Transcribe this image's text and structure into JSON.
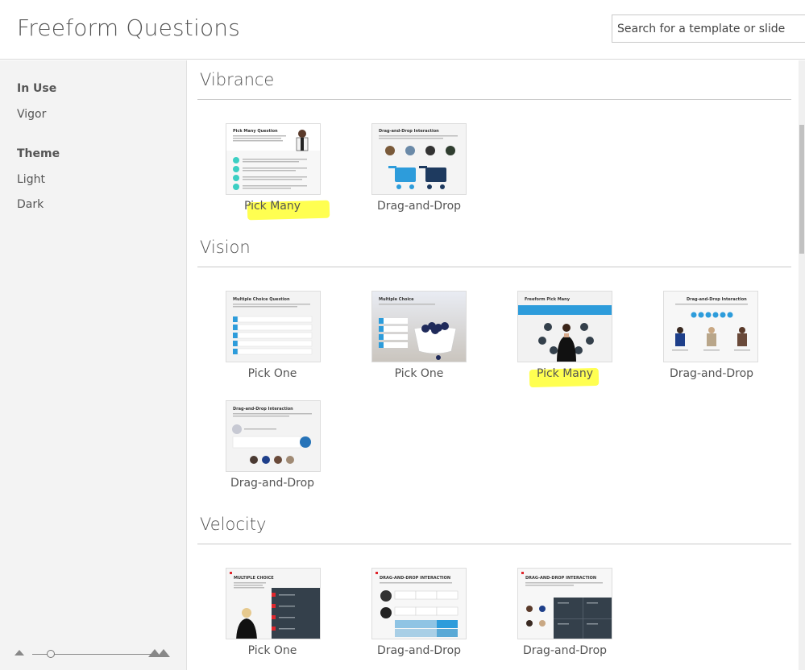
{
  "header": {
    "title": "Freeform Questions",
    "search_placeholder": "Search for a template or slide"
  },
  "sidebar": {
    "in_use_heading": "In Use",
    "in_use_item": "Vigor",
    "theme_heading": "Theme",
    "theme_items": [
      "Light",
      "Dark"
    ]
  },
  "sections": [
    {
      "title": "Vibrance",
      "cards": [
        {
          "label": "Pick Many",
          "thumb_title": "Pick Many Question",
          "highlighted": true
        },
        {
          "label": "Drag-and-Drop",
          "thumb_title": "Drag-and-Drop Interaction"
        }
      ]
    },
    {
      "title": "Vision",
      "cards": [
        {
          "label": "Pick One",
          "thumb_title": "Multiple Choice Question"
        },
        {
          "label": "Pick One",
          "thumb_title": "Multiple Choice"
        },
        {
          "label": "Pick Many",
          "thumb_title": "Freeform Pick Many",
          "highlighted": true
        },
        {
          "label": "Drag-and-Drop",
          "thumb_title": "Drag-and-Drop Interaction"
        },
        {
          "label": "Drag-and-Drop",
          "thumb_title": "Drag-and-Drop Interaction"
        }
      ]
    },
    {
      "title": "Velocity",
      "cards": [
        {
          "label": "Pick One",
          "thumb_title": "MULTIPLE CHOICE"
        },
        {
          "label": "Drag-and-Drop",
          "thumb_title": "DRAG-AND-DROP INTERACTION"
        },
        {
          "label": "Drag-and-Drop",
          "thumb_title": "DRAG-AND-DROP INTERACTION"
        }
      ]
    }
  ],
  "colors": {
    "highlight": "#ffff33",
    "accent_blue": "#2d9cdb",
    "teal": "#3ccfc3",
    "dark_navy": "#34404b",
    "velocity_red": "#e0262c"
  }
}
